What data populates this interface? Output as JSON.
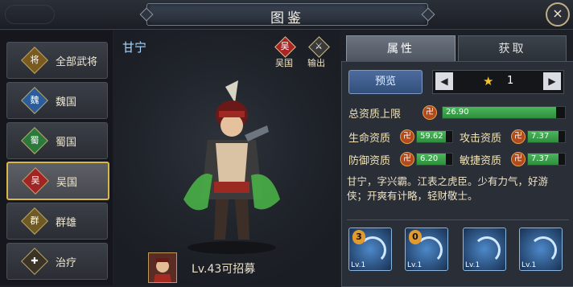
{
  "header": {
    "title": "图鉴",
    "close_icon": "×"
  },
  "sidebar": {
    "items": [
      {
        "label": "全部武将",
        "glyph": "将"
      },
      {
        "label": "魏国",
        "glyph": "魏"
      },
      {
        "label": "蜀国",
        "glyph": "蜀"
      },
      {
        "label": "吴国",
        "glyph": "吴"
      },
      {
        "label": "群雄",
        "glyph": "群"
      },
      {
        "label": "治疗",
        "glyph": "✚"
      }
    ]
  },
  "hero": {
    "name": "甘宁",
    "faction_badge": "吴",
    "faction_label": "吴国",
    "role_label": "输出",
    "level_text": "Lv.43可招募"
  },
  "tabs": {
    "attributes": "属性",
    "acquire": "获取"
  },
  "panel": {
    "preview_label": "预览",
    "star_value": "1",
    "total": {
      "label": "总资质上限",
      "value": "26.90",
      "fill": 0.93
    },
    "stats": [
      {
        "label": "生命资质",
        "value": "59.62",
        "fill": 0.82
      },
      {
        "label": "攻击资质",
        "value": "7.37",
        "fill": 0.83
      },
      {
        "label": "防御资质",
        "value": "6.20",
        "fill": 0.82
      },
      {
        "label": "敏捷资质",
        "value": "7.37",
        "fill": 0.83
      }
    ],
    "coin_glyph": "卍",
    "description": "甘宁，字兴霸。江表之虎臣。少有力气，好游侠；开爽有计略，轻财敬士。",
    "skills": [
      {
        "count": "3",
        "lv": "Lv.1"
      },
      {
        "count": "0",
        "lv": "Lv.1"
      },
      {
        "count": "",
        "lv": "Lv.1"
      },
      {
        "count": "",
        "lv": "Lv.1"
      }
    ]
  },
  "colors": {
    "accent_gold": "#d8b64a",
    "bar_green": "#3fa54f",
    "tab_active": "#5b636e"
  }
}
